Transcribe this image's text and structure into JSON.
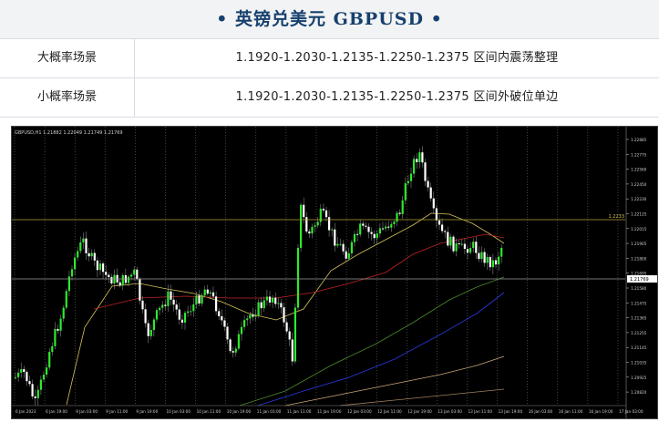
{
  "header": {
    "title": "• 英镑兑美元  GBPUSD •"
  },
  "scenarios": [
    {
      "label": "大概率场景",
      "value": "1.1920-1.2030-1.2135-1.2250-1.2375 区间内震荡整理"
    },
    {
      "label": "小概率场景",
      "value": "1.1920-1.2030-1.2135-1.2250-1.2375 区间外破位单边"
    }
  ],
  "chart": {
    "symbol_header": "GBPUSD,H1  1.21882 1.22049 1.21749 1.21769",
    "level_label": "1.2233",
    "price_ticks": [
      "1.22885",
      "1.22775",
      "1.22560",
      "1.22450",
      "1.22230",
      "1.22125",
      "1.22015",
      "1.21905",
      "1.21800",
      "1.21695",
      "1.21580",
      "1.21475",
      "1.21365",
      "1.21255",
      "1.21145",
      "1.21035",
      "1.20925",
      "1.20820"
    ],
    "time_ticks": [
      "6 Jan 2023",
      "6 Jan 19:00",
      "9 Jan 03:00",
      "9 Jan 11:00",
      "9 Jan 19:00",
      "10 Jan 03:00",
      "10 Jan 11:00",
      "10 Jan 19:00",
      "11 Jan 03:00",
      "11 Jan 11:00",
      "11 Jan 19:00",
      "12 Jan 03:00",
      "12 Jan 11:00",
      "12 Jan 19:00",
      "13 Jan 03:00",
      "13 Jan 11:00",
      "13 Jan 19:00",
      "16 Jan 03:00",
      "16 Jan 11:00",
      "16 Jan 19:00",
      "17 Jan 03:00"
    ],
    "current_price": "1.21769",
    "colors": {
      "bull": "#2ee82e",
      "bear": "#ffffff",
      "ma_fast": "#d4c45a",
      "ma_mid": "#c42424",
      "ma_slow": "#4a8a2a",
      "ma_blue": "#2a3ae0",
      "ma_tan1": "#c8a878",
      "ma_tan2": "#a08060"
    }
  }
}
